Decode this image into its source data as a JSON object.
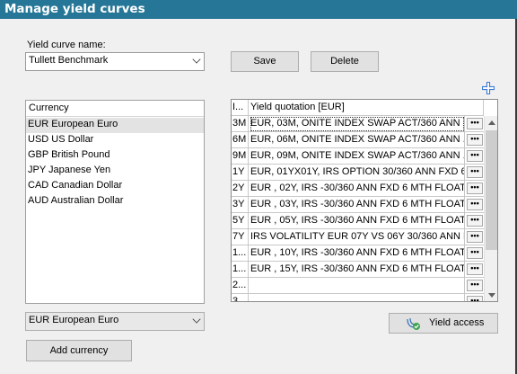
{
  "window": {
    "title": "Manage yield curves"
  },
  "curve": {
    "name_label": "Yield curve name:",
    "name_value": "Tullett Benchmark",
    "save_label": "Save",
    "delete_label": "Delete"
  },
  "currency": {
    "header": "Currency",
    "items": [
      "EUR European Euro",
      "USD US Dollar",
      "GBP British Pound",
      "JPY Japanese Yen",
      "CAD Canadian Dollar",
      "AUD Australian Dollar"
    ],
    "selected_index": 0,
    "dropdown_value": "EUR European Euro",
    "add_label": "Add currency"
  },
  "grid": {
    "col1_header": "I...",
    "col2_header": "Yield quotation [EUR]",
    "rows": [
      {
        "tenor": "3M",
        "quote": "EUR, 03M, ONITE INDEX SWAP ACT/360 ANN ..."
      },
      {
        "tenor": "6M",
        "quote": "EUR, 06M, ONITE INDEX SWAP ACT/360 ANN ..."
      },
      {
        "tenor": "9M",
        "quote": "EUR, 09M, ONITE INDEX SWAP ACT/360 ANN ..."
      },
      {
        "tenor": "1Y",
        "quote": "EUR, 01YX01Y, IRS OPTION 30/360 ANN FXD 6..."
      },
      {
        "tenor": "2Y",
        "quote": "EUR , 02Y, IRS -30/360 ANN FXD 6 MTH FLOAT"
      },
      {
        "tenor": "3Y",
        "quote": "EUR , 03Y, IRS -30/360 ANN FXD 6 MTH FLOAT"
      },
      {
        "tenor": "5Y",
        "quote": "EUR , 05Y, IRS -30/360 ANN FXD 6 MTH FLOAT"
      },
      {
        "tenor": "7Y",
        "quote": "IRS VOLATILITY EUR 07Y VS 06Y 30/360 ANN F..."
      },
      {
        "tenor": "1...",
        "quote": "EUR , 10Y, IRS -30/360 ANN FXD 6 MTH FLOAT"
      },
      {
        "tenor": "1...",
        "quote": "EUR , 15Y, IRS -30/360 ANN FXD 6 MTH FLOAT"
      },
      {
        "tenor": "2...",
        "quote": ""
      },
      {
        "tenor": "3...",
        "quote": ""
      }
    ],
    "dots_label": "•••"
  },
  "yield_access": {
    "label": "Yield access"
  },
  "icons": {
    "add": "plus-icon",
    "yield_access": "yield-access-icon"
  },
  "colors": {
    "titlebar": "#267697",
    "plus": "#3a7bd5"
  }
}
